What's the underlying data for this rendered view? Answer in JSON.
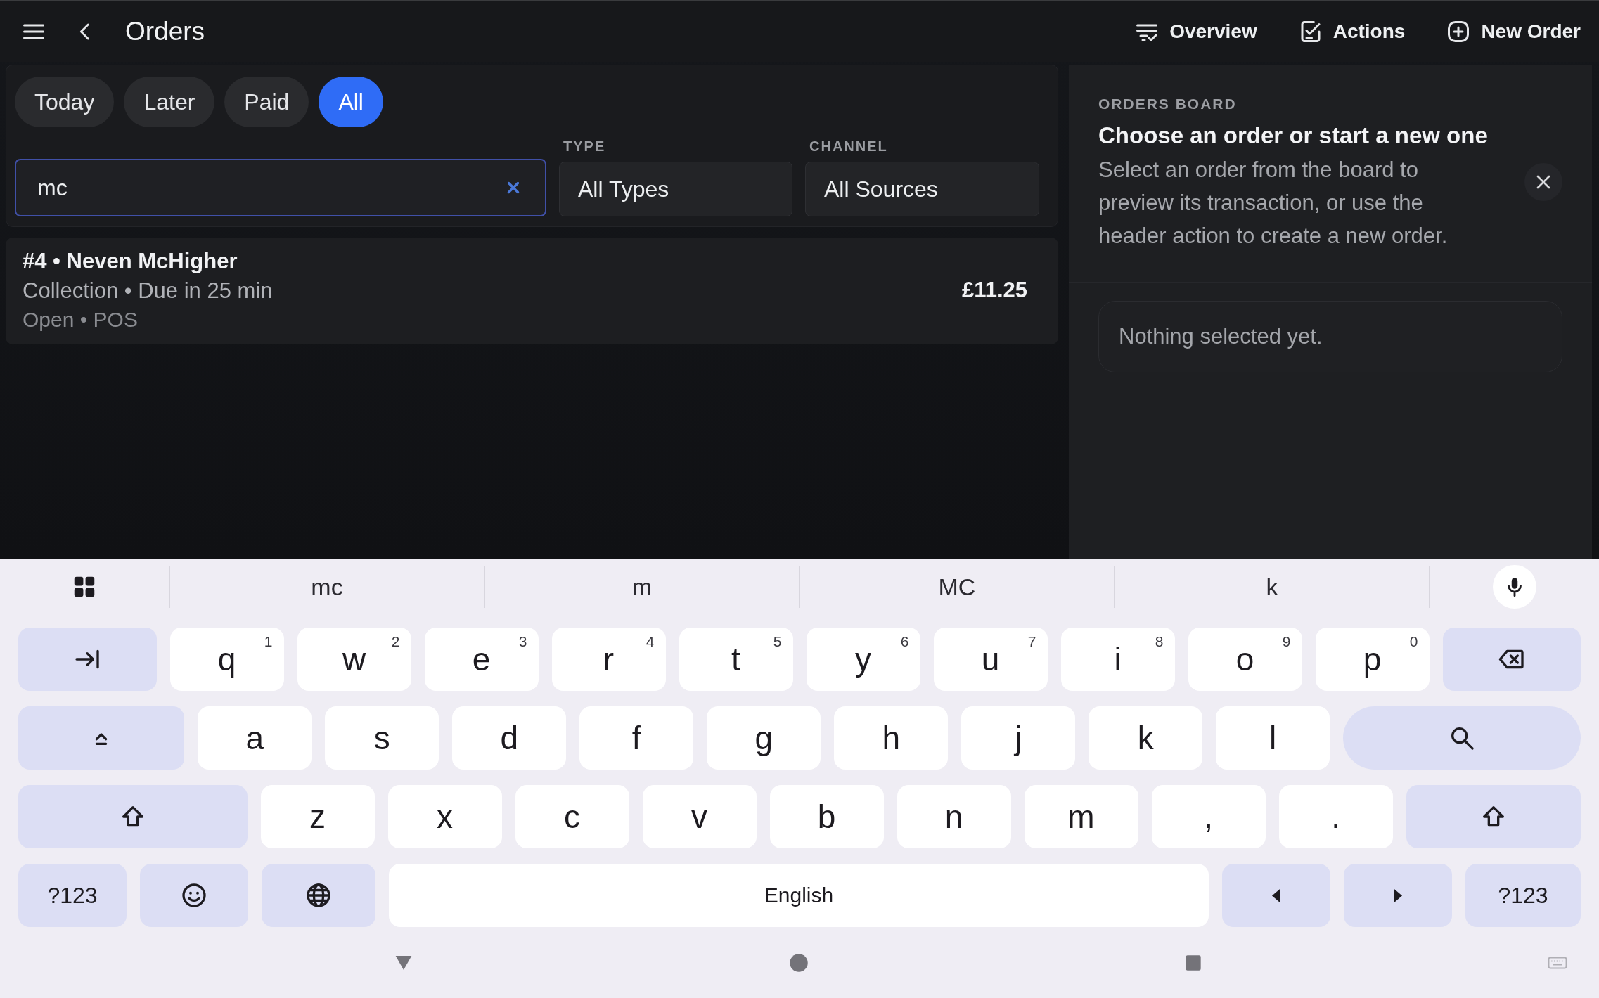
{
  "header": {
    "title": "Orders",
    "actions": [
      {
        "kind": "overview",
        "label": "Overview"
      },
      {
        "kind": "actions",
        "label": "Actions"
      },
      {
        "kind": "new",
        "label": "New Order"
      }
    ]
  },
  "filters": [
    {
      "label": "Today",
      "selected": false
    },
    {
      "label": "Later",
      "selected": false
    },
    {
      "label": "Paid",
      "selected": false
    },
    {
      "label": "All",
      "selected": true
    }
  ],
  "search": {
    "value": "mc"
  },
  "type_filter": {
    "label": "TYPE",
    "value": "All Types"
  },
  "channel_filter": {
    "label": "CHANNEL",
    "value": "All Sources"
  },
  "orders": [
    {
      "title": "#4 • Neven McHigher",
      "details": "Collection • Due in 25 min",
      "status": "Open • POS",
      "total": "£11.25"
    }
  ],
  "board": {
    "eyebrow": "ORDERS BOARD",
    "heading": "Choose an order or start a new one",
    "body": "Select an order from the board to preview its transaction, or use the header action to create a new order.",
    "empty": "Nothing selected yet."
  },
  "keyboard": {
    "suggestions": [
      "mc",
      "m",
      "MC",
      "k"
    ],
    "rows": [
      [
        {
          "kind": "tab"
        },
        {
          "kind": "letter",
          "label": "q",
          "hint": "1"
        },
        {
          "kind": "letter",
          "label": "w",
          "hint": "2"
        },
        {
          "kind": "letter",
          "label": "e",
          "hint": "3"
        },
        {
          "kind": "letter",
          "label": "r",
          "hint": "4"
        },
        {
          "kind": "letter",
          "label": "t",
          "hint": "5"
        },
        {
          "kind": "letter",
          "label": "y",
          "hint": "6"
        },
        {
          "kind": "letter",
          "label": "u",
          "hint": "7"
        },
        {
          "kind": "letter",
          "label": "i",
          "hint": "8"
        },
        {
          "kind": "letter",
          "label": "o",
          "hint": "9"
        },
        {
          "kind": "letter",
          "label": "p",
          "hint": "0"
        },
        {
          "kind": "backspace"
        }
      ],
      [
        {
          "kind": "caps"
        },
        {
          "kind": "letter",
          "label": "a"
        },
        {
          "kind": "letter",
          "label": "s"
        },
        {
          "kind": "letter",
          "label": "d"
        },
        {
          "kind": "letter",
          "label": "f"
        },
        {
          "kind": "letter",
          "label": "g"
        },
        {
          "kind": "letter",
          "label": "h"
        },
        {
          "kind": "letter",
          "label": "j"
        },
        {
          "kind": "letter",
          "label": "k"
        },
        {
          "kind": "letter",
          "label": "l"
        },
        {
          "kind": "search"
        }
      ],
      [
        {
          "kind": "shift"
        },
        {
          "kind": "letter",
          "label": "z"
        },
        {
          "kind": "letter",
          "label": "x"
        },
        {
          "kind": "letter",
          "label": "c"
        },
        {
          "kind": "letter",
          "label": "v"
        },
        {
          "kind": "letter",
          "label": "b"
        },
        {
          "kind": "letter",
          "label": "n"
        },
        {
          "kind": "letter",
          "label": "m"
        },
        {
          "kind": "letter",
          "label": ","
        },
        {
          "kind": "letter",
          "label": "."
        },
        {
          "kind": "shift"
        }
      ],
      [
        {
          "kind": "symbols",
          "label": "?123"
        },
        {
          "kind": "emoji"
        },
        {
          "kind": "language"
        },
        {
          "kind": "space",
          "label": "English"
        },
        {
          "kind": "left"
        },
        {
          "kind": "right"
        },
        {
          "kind": "symbols",
          "label": "?123"
        }
      ]
    ]
  }
}
